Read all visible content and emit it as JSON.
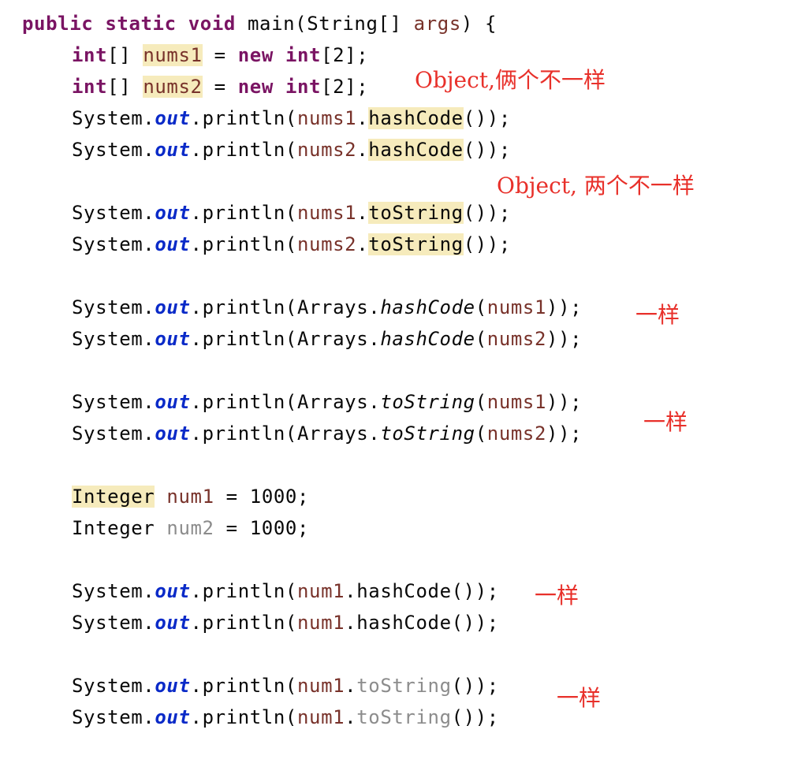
{
  "code": {
    "lines": [
      {
        "parts": [
          "public",
          " ",
          "static",
          " ",
          "void",
          " main(String[] ",
          "args",
          ") {"
        ]
      },
      {
        "parts": [
          "int",
          "[] ",
          "nums1",
          " = ",
          "new",
          " ",
          "int",
          "[2];"
        ]
      },
      {
        "parts": [
          "int",
          "[] ",
          "nums2",
          " = ",
          "new",
          " ",
          "int",
          "[2];"
        ]
      },
      {
        "parts": [
          "System.",
          "out",
          ".println(",
          "nums1",
          ".",
          "hashCode",
          "());"
        ]
      },
      {
        "parts": [
          "System.",
          "out",
          ".println(",
          "nums2",
          ".",
          "hashCode",
          "());"
        ]
      },
      {
        "parts": []
      },
      {
        "parts": [
          "System.",
          "out",
          ".println(",
          "nums1",
          ".",
          "toString",
          "());"
        ]
      },
      {
        "parts": [
          "System.",
          "out",
          ".println(",
          "nums2",
          ".",
          "toString",
          "());"
        ]
      },
      {
        "parts": []
      },
      {
        "parts": [
          "System.",
          "out",
          ".println(Arrays.",
          "hashCode",
          "(",
          "nums1",
          "));"
        ]
      },
      {
        "parts": [
          "System.",
          "out",
          ".println(Arrays.",
          "hashCode",
          "(",
          "nums2",
          "));"
        ]
      },
      {
        "parts": []
      },
      {
        "parts": [
          "System.",
          "out",
          ".println(Arrays.",
          "toString",
          "(",
          "nums1",
          "));"
        ]
      },
      {
        "parts": [
          "System.",
          "out",
          ".println(Arrays.",
          "toString",
          "(",
          "nums2",
          "));"
        ]
      },
      {
        "parts": []
      },
      {
        "parts": [
          "Integer",
          " ",
          "num1",
          " = 1000;"
        ]
      },
      {
        "parts": [
          "Integer ",
          "num2",
          " = 1000;"
        ]
      },
      {
        "parts": []
      },
      {
        "parts": [
          "System.",
          "out",
          ".println(",
          "num1",
          ".hashCode());"
        ]
      },
      {
        "parts": [
          "System.",
          "out",
          ".println(",
          "num1",
          ".hashCode());"
        ]
      },
      {
        "parts": []
      },
      {
        "parts": [
          "System.",
          "out",
          ".println(",
          "num1",
          ".",
          "toString",
          "());"
        ]
      },
      {
        "parts": [
          "System.",
          "out",
          ".println(",
          "num1",
          ".",
          "toString",
          "());"
        ]
      }
    ]
  },
  "annotations": [
    "Object,俩个不一样",
    "Object, 两个不一样",
    "一样",
    "一样",
    "一样",
    "一样"
  ],
  "colors": {
    "keyword": "#0033b3",
    "modifier": "#7a1463",
    "static_field": "#0a2ac8",
    "local_variable": "#78322a",
    "highlight": "#f6ebbc",
    "unused": "#8c8c8c",
    "annotation": "#e8302a"
  }
}
